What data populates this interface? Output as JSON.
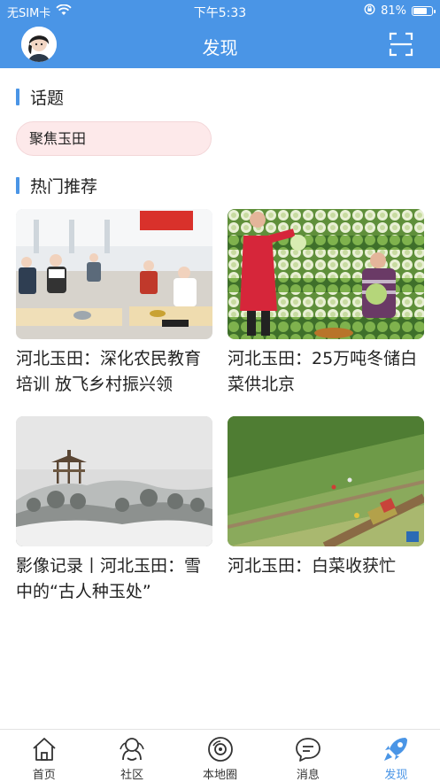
{
  "status_bar": {
    "carrier": "无SIM卡",
    "time": "下午5:33",
    "battery_percent": "81%",
    "battery_level": 0.81
  },
  "header": {
    "title": "发现"
  },
  "topics": {
    "heading": "话题",
    "chip_label": "聚焦玉田"
  },
  "hot": {
    "heading": "热门推荐",
    "cards": [
      {
        "caption": "河北玉田：深化农民教育培训 放飞乡村振兴领"
      },
      {
        "caption": "河北玉田：25万吨冬储白菜供北京"
      },
      {
        "caption": "影像记录丨河北玉田：雪中的“古人种玉处”"
      },
      {
        "caption": "河北玉田：白菜收获忙"
      }
    ]
  },
  "tabbar": {
    "tabs": [
      {
        "label": "首页",
        "icon": "home-icon"
      },
      {
        "label": "社区",
        "icon": "community-icon"
      },
      {
        "label": "本地圈",
        "icon": "local-circle-icon"
      },
      {
        "label": "消息",
        "icon": "message-icon"
      },
      {
        "label": "发现",
        "icon": "discover-icon",
        "active": true
      }
    ]
  },
  "colors": {
    "brand_blue": "#4a95e6",
    "chip_bg": "#fde9ea"
  }
}
